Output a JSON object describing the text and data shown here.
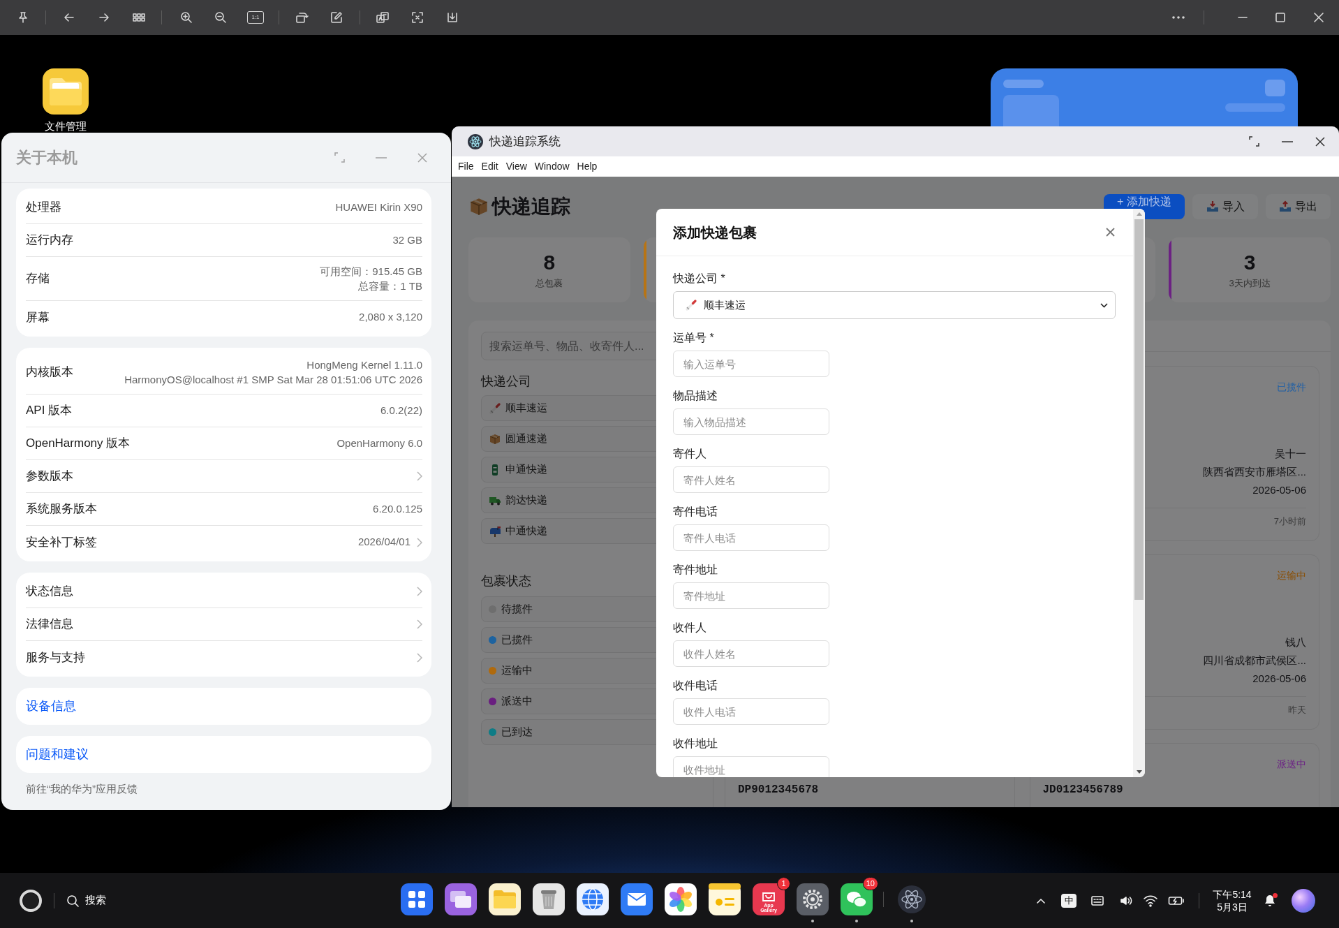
{
  "image_viewer_toolbar": {
    "actual_size": "1:1"
  },
  "desktop": {
    "icons": [
      {
        "label": "文件管理"
      }
    ]
  },
  "about_window": {
    "title": "关于本机",
    "groups": [
      {
        "rows": [
          {
            "label": "处理器",
            "value": "HUAWEI Kirin X90",
            "kind": "info"
          },
          {
            "label": "运行内存",
            "value": "32 GB",
            "kind": "info"
          },
          {
            "label": "存储",
            "value_lines": [
              "可用空间：915.45 GB",
              "总容量：1 TB"
            ],
            "kind": "info"
          },
          {
            "label": "屏幕",
            "value": "2,080 x 3,120",
            "kind": "info"
          }
        ]
      },
      {
        "rows": [
          {
            "label": "内核版本",
            "value_lines": [
              "HongMeng Kernel 1.11.0",
              "HarmonyOS@localhost #1 SMP Sat Mar 28 01:51:06 UTC 2026"
            ],
            "kind": "info"
          },
          {
            "label": "API 版本",
            "value": "6.0.2(22)",
            "kind": "info"
          },
          {
            "label": "OpenHarmony 版本",
            "value": "OpenHarmony 6.0",
            "kind": "info"
          },
          {
            "label": "参数版本",
            "kind": "nav"
          },
          {
            "label": "系统服务版本",
            "value": "6.20.0.125",
            "kind": "info"
          },
          {
            "label": "安全补丁标签",
            "value": "2026/04/01",
            "kind": "nav"
          }
        ]
      },
      {
        "rows": [
          {
            "label": "状态信息",
            "kind": "nav"
          },
          {
            "label": "法律信息",
            "kind": "nav"
          },
          {
            "label": "服务与支持",
            "kind": "nav"
          }
        ]
      }
    ],
    "links": [
      {
        "label": "设备信息"
      },
      {
        "label": "问题和建议"
      }
    ],
    "footer": "前往“我的华为”应用反馈"
  },
  "app_window": {
    "title": "快递追踪系统",
    "menu": [
      "File",
      "Edit",
      "View",
      "Window",
      "Help"
    ],
    "heading": "快递追踪",
    "actions": [
      {
        "label": "+ 添加快递",
        "kind": "primary"
      },
      {
        "label": "导入",
        "kind": "import"
      },
      {
        "label": "导出",
        "kind": "export"
      }
    ],
    "stats": [
      {
        "value": "8",
        "label": "总包裹"
      },
      {
        "color": "#b87414"
      },
      {
        "value": "3",
        "label": "3天内到达",
        "color": "#6c2183"
      }
    ],
    "sidebar": {
      "search_placeholder": "搜索运单号、物品、收寄件人...",
      "companies_heading": "快递公司",
      "companies": [
        {
          "name": "顺丰速运",
          "kind": "marker"
        },
        {
          "name": "圆通速递",
          "kind": "box"
        },
        {
          "name": "申通快递",
          "kind": "pillar"
        },
        {
          "name": "韵达快递",
          "kind": "truck"
        },
        {
          "name": "中通快递",
          "kind": "mailbox"
        }
      ],
      "statuses_heading": "包裹状态",
      "statuses": [
        {
          "name": "待揽件",
          "color": "#6e6e6e"
        },
        {
          "name": "已揽件",
          "color": "#1d63a0"
        },
        {
          "name": "运输中",
          "color": "#b06a0c"
        },
        {
          "name": "派送中",
          "color": "#6a1e80"
        },
        {
          "name": "已到达",
          "color": "#0e7c86"
        }
      ]
    },
    "package_columns": [
      {
        "packages": [
          {
            "tracking": "DP9012345678"
          }
        ]
      },
      {
        "packages": [
          {
            "status": "已揽件",
            "color": "#1f5fa6",
            "recipient": "吴十一",
            "address": "陕西省西安市雁塔区...",
            "date": "2026-05-06",
            "updated": "7小时前"
          },
          {
            "status": "运输中",
            "color": "#8a4d00",
            "recipient": "钱八",
            "address": "四川省成都市武侯区...",
            "date": "2026-05-06",
            "updated": "昨天"
          },
          {
            "status": "派送中",
            "color": "#6b1f85",
            "tracking": "JD0123456789"
          }
        ]
      }
    ]
  },
  "modal": {
    "title": "添加快递包裹",
    "fields": [
      {
        "label": "快递公司 *",
        "kind": "select",
        "value": "顺丰速运"
      },
      {
        "label": "运单号 *",
        "kind": "input",
        "placeholder": "输入运单号"
      },
      {
        "label": "物品描述",
        "kind": "input",
        "placeholder": "输入物品描述"
      },
      {
        "label": "寄件人",
        "kind": "input",
        "placeholder": "寄件人姓名"
      },
      {
        "label": "寄件电话",
        "kind": "input",
        "placeholder": "寄件人电话"
      },
      {
        "label": "寄件地址",
        "kind": "input",
        "placeholder": "寄件地址"
      },
      {
        "label": "收件人",
        "kind": "input",
        "placeholder": "收件人姓名"
      },
      {
        "label": "收件电话",
        "kind": "input",
        "placeholder": "收件人电话"
      },
      {
        "label": "收件地址",
        "kind": "input",
        "placeholder": "收件地址"
      }
    ]
  },
  "taskbar": {
    "search_label": "搜索",
    "apps": [
      {
        "kind": "grid",
        "running": false
      },
      {
        "kind": "windows",
        "running": false
      },
      {
        "kind": "folder",
        "running": false
      },
      {
        "kind": "trash",
        "running": false
      },
      {
        "kind": "globe",
        "running": false
      },
      {
        "kind": "mail",
        "running": false
      },
      {
        "kind": "flower",
        "running": false
      },
      {
        "kind": "notes",
        "running": false
      },
      {
        "kind": "gallery",
        "label": "App Gallery",
        "badge": "1",
        "running": false
      },
      {
        "kind": "gear",
        "running": true
      },
      {
        "kind": "chat",
        "badge": "10",
        "running": true
      }
    ],
    "open_apps": [
      {
        "kind": "atom",
        "running": true
      }
    ],
    "input_method": "中",
    "time": "下午5:14",
    "date": "5月3日",
    "notification_dot": true
  }
}
